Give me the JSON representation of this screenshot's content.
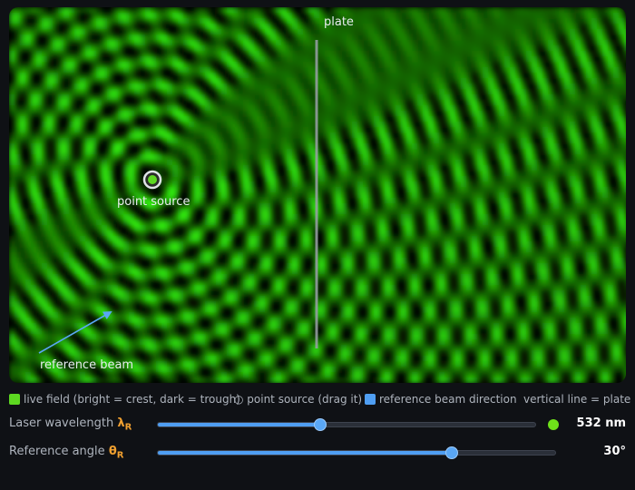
{
  "simulation": {
    "plate_label": "plate",
    "point_source_label": "point source",
    "reference_beam_label": "reference beam",
    "field_color": "#4ee61a",
    "arrow_color": "#5aa7f5",
    "plate_color": "#9aa0a8"
  },
  "legend": {
    "live_field": "live field (bright = crest, dark = trough)",
    "point_source": "○ point source (drag it)",
    "reference_direction": "reference beam direction",
    "plate_note": "vertical line = plate",
    "live_field_color": "#5dd821",
    "reference_color": "#4f9ef2"
  },
  "controls": {
    "wavelength": {
      "label": "Laser wavelength",
      "symbol": "λ",
      "subscript": "R",
      "value_text": "532 nm",
      "fraction": 0.43,
      "color_dot": "#6fe21a"
    },
    "angle": {
      "label": "Reference angle",
      "symbol": "θ",
      "subscript": "R",
      "value_text": "30°",
      "fraction": 0.74
    }
  }
}
